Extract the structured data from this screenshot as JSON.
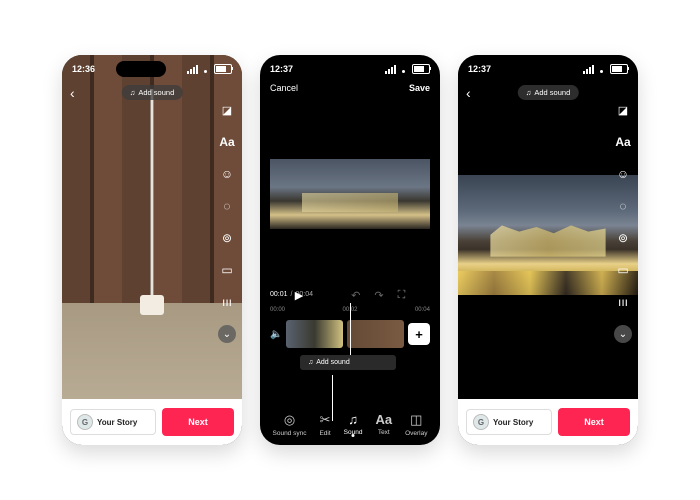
{
  "phone1": {
    "time": "12:36",
    "battery": "68",
    "add_sound": "Add sound",
    "story_initial": "G",
    "story_label": "Your Story",
    "next": "Next"
  },
  "phone2": {
    "time": "12:37",
    "battery": "66",
    "cancel": "Cancel",
    "save": "Save",
    "cur_time": "00:01",
    "total_time": "00:04",
    "tick0": "00:00",
    "tick1": "00:02",
    "tick2": "00:04",
    "add_sound": "Add sound",
    "tools": {
      "soundsync": "Sound sync",
      "edit": "Edit",
      "sound": "Sound",
      "text": "Text",
      "overlay": "Overlay"
    }
  },
  "phone3": {
    "time": "12:37",
    "battery": "66",
    "add_sound": "Add sound",
    "story_initial": "G",
    "story_label": "Your Story",
    "next": "Next"
  }
}
